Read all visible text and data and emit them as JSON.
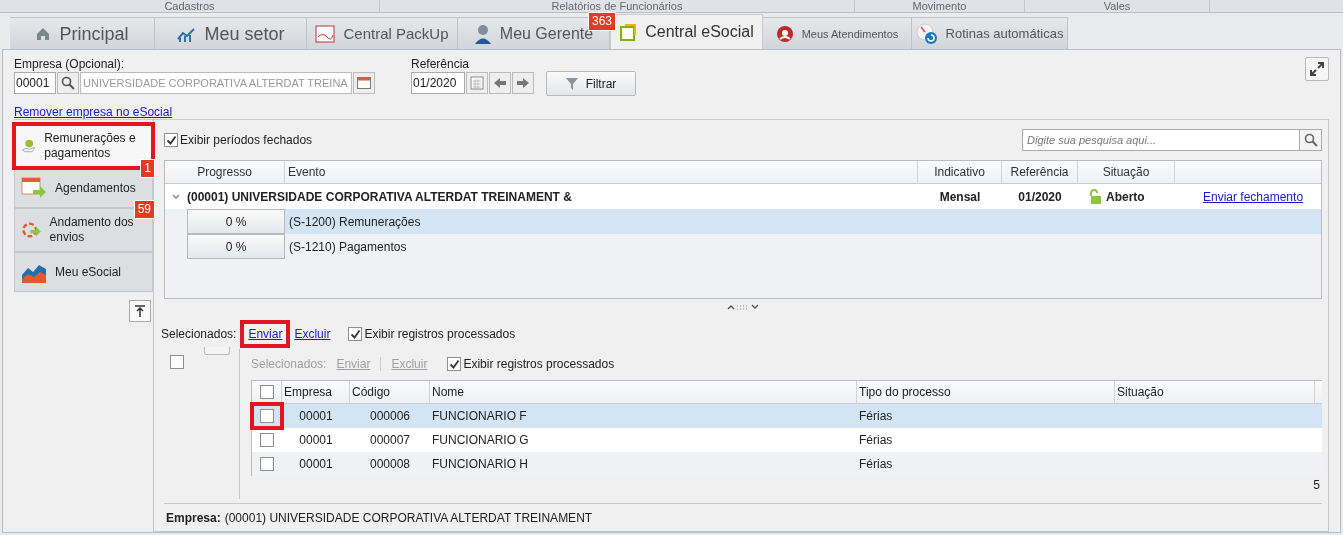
{
  "menu_bar": [
    "Cadastros",
    "Relatórios de Funcionários",
    "Movimento",
    "Vales"
  ],
  "tabs": [
    {
      "label": "Principal",
      "selected": false
    },
    {
      "label": "Meu setor",
      "selected": false
    },
    {
      "label": "Central PackUp",
      "selected": false
    },
    {
      "label": "Meu Gerente",
      "selected": false,
      "badge": "363"
    },
    {
      "label": "Central eSocial",
      "selected": true
    },
    {
      "label": "Meus Atendimentos",
      "selected": false
    },
    {
      "label": "Rotinas automáticas",
      "selected": false
    }
  ],
  "filters": {
    "empresa_label": "Empresa (Opcional):",
    "empresa_code": "00001",
    "empresa_name": "UNIVERSIDADE CORPORATIVA ALTERDAT TREINA",
    "referencia_label": "Referência",
    "referencia": "01/2020",
    "filter_button": "Filtrar",
    "remove_link": "Remover empresa no eSocial"
  },
  "sidebar": {
    "items": [
      {
        "label": "Remunerações e pagamentos",
        "selected": true,
        "highlighted": true,
        "badge": "1"
      },
      {
        "label": "Agendamentos",
        "selected": false,
        "highlighted": false
      },
      {
        "label": "Andamento dos envios",
        "selected": false,
        "highlighted": false,
        "badge": "59"
      },
      {
        "label": "Meu eSocial",
        "selected": false,
        "highlighted": false
      }
    ]
  },
  "events": {
    "show_closed": {
      "label": "Exibir períodos fechados",
      "checked": true
    },
    "search": {
      "placeholder": "Digite sua pesquisa aqui..."
    },
    "columns": [
      "Progresso",
      "Evento",
      "Indicativo",
      "Referência",
      "Situação"
    ],
    "group": {
      "name": "(00001) UNIVERSIDADE CORPORATIVA ALTERDAT TREINAMENT &",
      "expanded": true,
      "indicativo": "Mensal",
      "referencia": "01/2020",
      "situacao": "Aberto",
      "action": "Enviar fechamento"
    },
    "rows": [
      {
        "progress": "0 %",
        "level": 0,
        "event": "(S-1200) Remunerações",
        "selected": true
      },
      {
        "progress": "0 %",
        "level": 0,
        "event": "(S-1210) Pagamentos",
        "selected": false
      }
    ]
  },
  "actions": {
    "label": "Selecionados:",
    "send": "Enviar",
    "send_highlighted": true,
    "delete": "Excluir",
    "show_processed": {
      "label": "Exibir registros processados",
      "checked": true
    },
    "select_all_checked": false
  },
  "inner_actions": {
    "label": "Selecionados:",
    "send": "Enviar",
    "delete": "Excluir",
    "disabled": true,
    "show_processed": {
      "label": "Exibir registros processados",
      "checked": true
    }
  },
  "records": {
    "select_all_checked": false,
    "columns": [
      "Empresa",
      "Código",
      "Nome",
      "Tipo do processo",
      "Situação"
    ],
    "rows": [
      {
        "empresa": "00001",
        "codigo": "000006",
        "nome": "FUNCIONARIO F",
        "tipo": "Férias",
        "checked": false,
        "selected": true,
        "highlighted": true
      },
      {
        "empresa": "00001",
        "codigo": "000007",
        "nome": "FUNCIONARIO G",
        "tipo": "Férias",
        "checked": false,
        "selected": false,
        "highlighted": false
      },
      {
        "empresa": "00001",
        "codigo": "000008",
        "nome": "FUNCIONARIO H",
        "tipo": "Férias",
        "checked": false,
        "selected": false,
        "highlighted": false
      }
    ],
    "count": "5"
  },
  "footer": {
    "label": "Empresa:",
    "value": "(00001) UNIVERSIDADE CORPORATIVA ALTERDAT TREINAMENT"
  }
}
